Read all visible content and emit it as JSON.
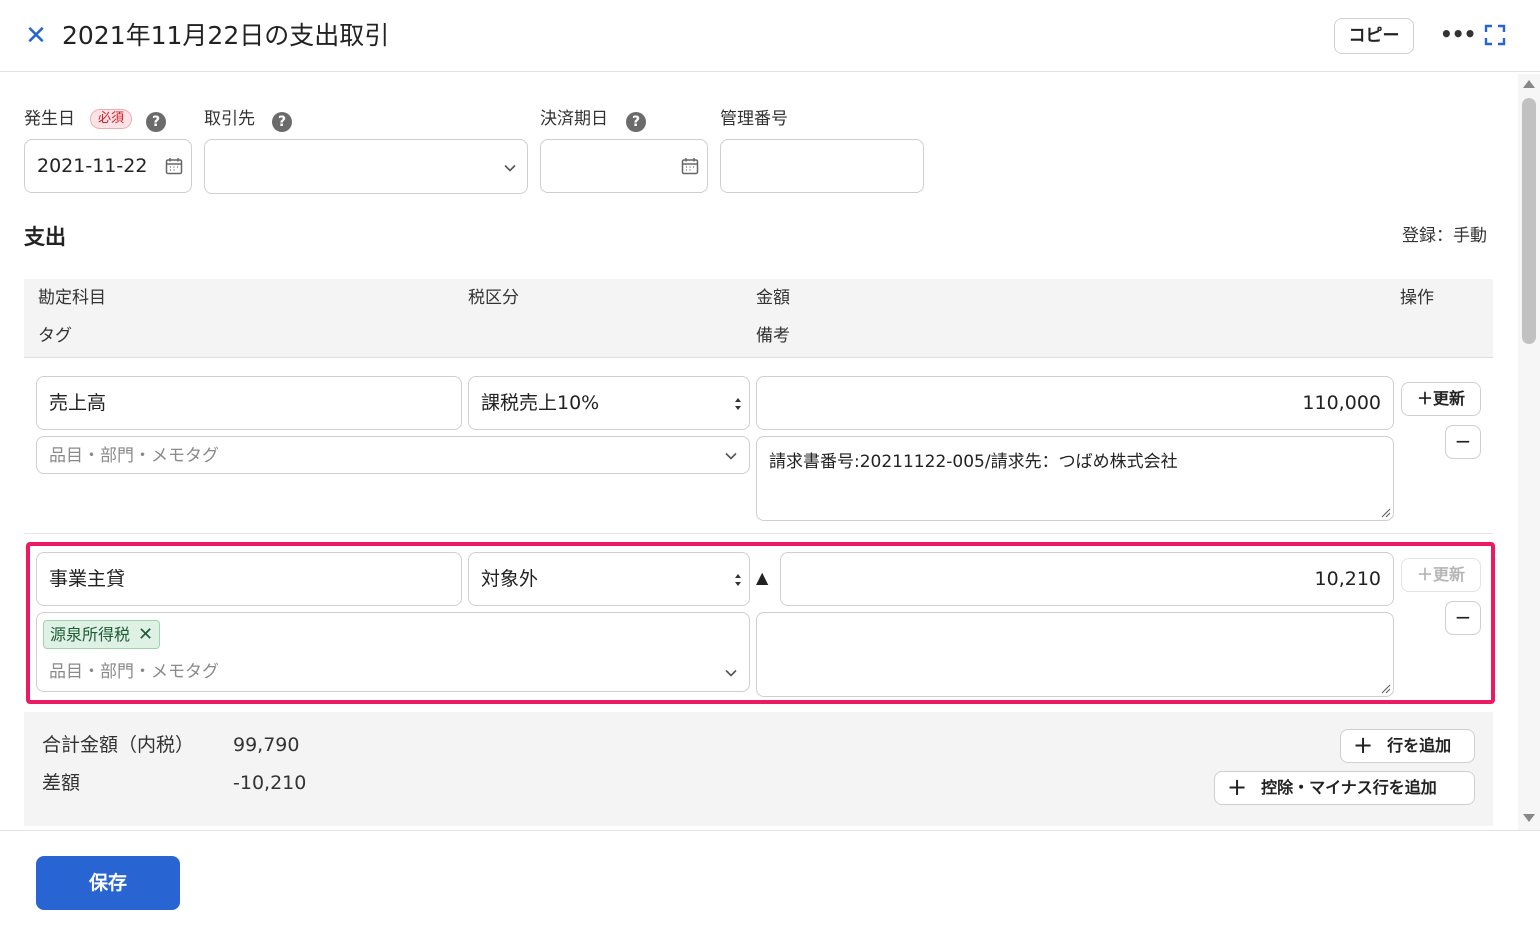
{
  "header": {
    "close_icon": "close-icon",
    "title": "2021年11月22日の支出取引",
    "copy_label": "コピー",
    "more_icon": "more-icon",
    "expand_icon": "fullscreen-icon"
  },
  "form": {
    "date_label": "発生日",
    "required_badge": "必須",
    "date_value": "2021-11-22",
    "partner_label": "取引先",
    "partner_value": "",
    "due_label": "決済期日",
    "due_value": "",
    "manage_label": "管理番号",
    "manage_value": ""
  },
  "section": {
    "title": "支出",
    "register_mode": "登録：手動"
  },
  "table": {
    "headers": {
      "account": "勘定科目",
      "tax": "税区分",
      "amount": "金額",
      "operation": "操作",
      "tag": "タグ",
      "memo": "備考"
    },
    "rows": [
      {
        "account": "売上高",
        "tax": "課税売上10%",
        "amount": "110,000",
        "tag_placeholder": "品目・部門・メモタグ",
        "memo": "請求書番号:20211122-005/請求先：つばめ株式会社",
        "update_label": "＋更新",
        "minus_label": "−"
      },
      {
        "account": "事業主貸",
        "tax": "対象外",
        "minus_sign": "▲",
        "amount": "10,210",
        "tag_chip": "源泉所得税",
        "tag_placeholder": "品目・部門・メモタグ",
        "memo": "",
        "update_label": "＋更新",
        "minus_label": "−"
      }
    ]
  },
  "summary": {
    "total_label": "合計金額（内税）",
    "total_value": "99,790",
    "diff_label": "差額",
    "diff_value": "-10,210",
    "add_row_label": "行を追加",
    "add_deduct_label": "控除・マイナス行を追加"
  },
  "footer": {
    "save_label": "保存"
  },
  "colors": {
    "accent": "#2864d2",
    "highlight": "#ec1a60",
    "required": "#c8202d",
    "tag_bg": "#dff1e5"
  }
}
